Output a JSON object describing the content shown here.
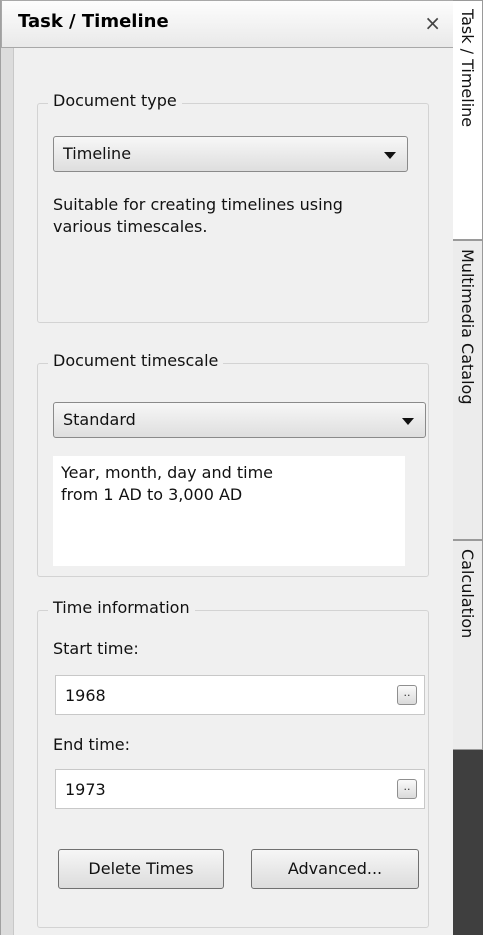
{
  "panel": {
    "title": "Task / Timeline",
    "close_glyph": "×"
  },
  "document_type": {
    "legend": "Document type",
    "selected": "Timeline",
    "description": "Suitable for creating timelines using various timescales."
  },
  "document_timescale": {
    "legend": "Document timescale",
    "selected": "Standard",
    "description_line1": "Year, month, day and time",
    "description_line2": "from 1 AD to 3,000 AD"
  },
  "time_information": {
    "legend": "Time information",
    "start_label": "Start time:",
    "start_value": "1968",
    "end_label": "End time:",
    "end_value": "1973",
    "ellipsis": "..",
    "delete_button": "Delete Times",
    "advanced_button": "Advanced..."
  },
  "side_tabs": [
    {
      "label": "Task / Timeline",
      "active": true
    },
    {
      "label": "Multimedia Catalog",
      "active": false
    },
    {
      "label": "Calculation",
      "active": false
    }
  ]
}
